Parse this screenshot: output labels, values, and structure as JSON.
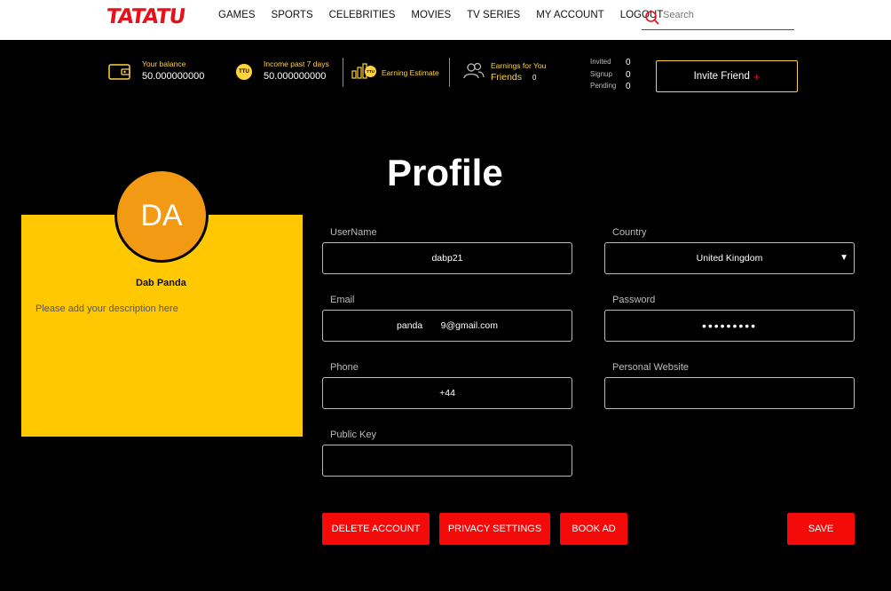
{
  "brand": {
    "logo": "TATATU",
    "accent": "#e8101a",
    "yellow": "#ffc800"
  },
  "nav": {
    "items": [
      "GAMES",
      "SPORTS",
      "CELEBRITIES",
      "MOVIES",
      "TV SERIES",
      "MY ACCOUNT",
      "LOGOUT"
    ]
  },
  "search": {
    "placeholder": "Search"
  },
  "stats": {
    "balance": {
      "label": "Your balance",
      "value": "50.000000000"
    },
    "income": {
      "label": "Income past 7 days",
      "value": "50.000000000",
      "coin": "TTU"
    },
    "earning_estimate": {
      "label": "Earning Estimate",
      "coin": "TTU"
    },
    "friends": {
      "label": "Earnings for You",
      "sub": "Friends",
      "value": "0"
    },
    "counts": {
      "invited_label": "Invited",
      "invited": "0",
      "signup_label": "Signup",
      "signup": "0",
      "pending_label": "Pending",
      "pending": "0"
    },
    "invite_button": "Invite Friend",
    "invite_plus": "+"
  },
  "profile": {
    "title": "Profile",
    "initials": "DA",
    "name": "Dab Panda",
    "description": "Please add your description here",
    "username_label": "UserName",
    "username": "dabp21",
    "country_label": "Country",
    "country": "United Kingdom",
    "email_label": "Email",
    "email": "panda       9@gmail.com",
    "password_label": "Password",
    "password": "•••••••••",
    "phone_label": "Phone",
    "phone": "+44",
    "website_label": "Personal Website",
    "website": "",
    "publickey_label": "Public Key",
    "publickey": ""
  },
  "actions": {
    "delete": "DELETE ACCOUNT",
    "privacy": "PRIVACY SETTINGS",
    "book": "BOOK AD",
    "save": "SAVE"
  }
}
